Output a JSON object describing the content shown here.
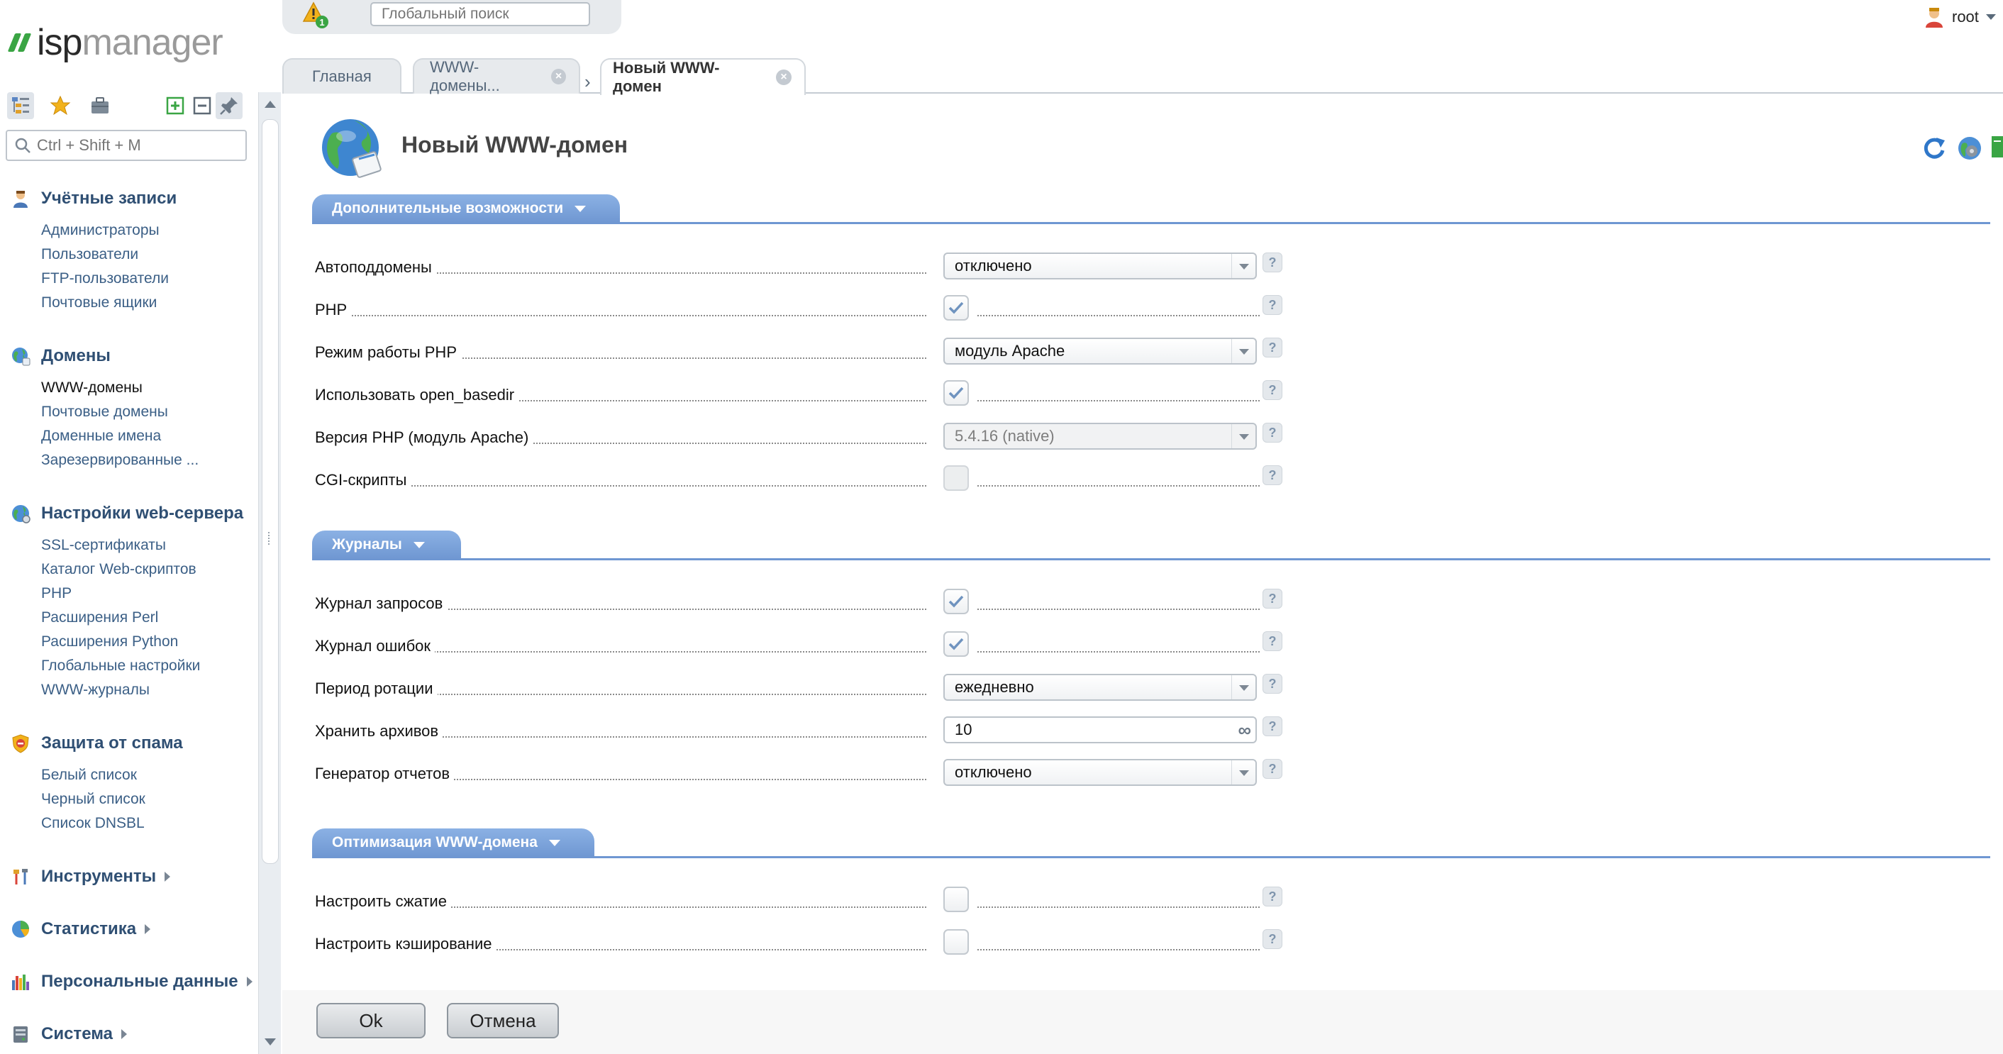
{
  "app": {
    "logo_isp": "isp",
    "logo_manager": "manager"
  },
  "sidebar": {
    "search_placeholder": "Ctrl + Shift + M",
    "groups": [
      {
        "title": "Учётные записи",
        "items": [
          "Администраторы",
          "Пользователи",
          "FTP-пользователи",
          "Почтовые ящики"
        ]
      },
      {
        "title": "Домены",
        "items": [
          "WWW-домены",
          "Почтовые домены",
          "Доменные имена",
          "Зарезервированные ..."
        ]
      },
      {
        "title": "Настройки web-сервера",
        "items": [
          "SSL-сертификаты",
          "Каталог Web-скриптов",
          "PHP",
          "Расширения Perl",
          "Расширения Python",
          "Глобальные настройки",
          "WWW-журналы"
        ]
      },
      {
        "title": "Защита от спама",
        "items": [
          "Белый список",
          "Черный список",
          "Список DNSBL"
        ]
      },
      {
        "title": "Инструменты"
      },
      {
        "title": "Статистика"
      },
      {
        "title": "Персональные данные"
      },
      {
        "title": "Система"
      }
    ],
    "selected_item": "WWW-домены"
  },
  "topbar": {
    "search_placeholder": "Глобальный поиск",
    "alert_count": "1",
    "user": "root"
  },
  "tabs": [
    {
      "label": "Главная"
    },
    {
      "label": "WWW-домены..."
    },
    {
      "label": "Новый WWW-домен"
    }
  ],
  "page": {
    "title": "Новый WWW-домен"
  },
  "sections": {
    "extra": {
      "title": "Дополнительные возможности",
      "rows": [
        {
          "label": "Автоподдомены",
          "type": "select",
          "value": "отключено"
        },
        {
          "label": "PHP",
          "type": "checkbox",
          "checked": true
        },
        {
          "label": "Режим работы PHP",
          "type": "select",
          "value": "модуль Apache"
        },
        {
          "label": "Использовать open_basedir",
          "type": "checkbox",
          "checked": true
        },
        {
          "label": "Версия PHP (модуль Apache)",
          "type": "select",
          "value": "5.4.16 (native)",
          "disabled": true
        },
        {
          "label": "CGI-скрипты",
          "type": "checkbox",
          "checked": false,
          "disabled": true
        }
      ]
    },
    "logs": {
      "title": "Журналы",
      "rows": [
        {
          "label": "Журнал запросов",
          "type": "checkbox",
          "checked": true
        },
        {
          "label": "Журнал ошибок",
          "type": "checkbox",
          "checked": true
        },
        {
          "label": "Период ротации",
          "type": "select",
          "value": "ежедневно"
        },
        {
          "label": "Хранить архивов",
          "type": "input",
          "value": "10"
        },
        {
          "label": "Генератор отчетов",
          "type": "select",
          "value": "отключено"
        }
      ]
    },
    "optim": {
      "title": "Оптимизация WWW-домена",
      "rows": [
        {
          "label": "Настроить сжатие",
          "type": "checkbox",
          "checked": false
        },
        {
          "label": "Настроить кэширование",
          "type": "checkbox",
          "checked": false
        }
      ]
    }
  },
  "help_glyph": "?",
  "infinity_glyph": "∞",
  "close_glyph": "×",
  "tab_separator": "›",
  "footer": {
    "ok_label": "Ok",
    "cancel_label": "Отмена"
  },
  "colors": {
    "accent": "#6f97d2",
    "link": "#3b5f86",
    "group_title": "#2f4f73",
    "brand_green": "#3aa544"
  }
}
